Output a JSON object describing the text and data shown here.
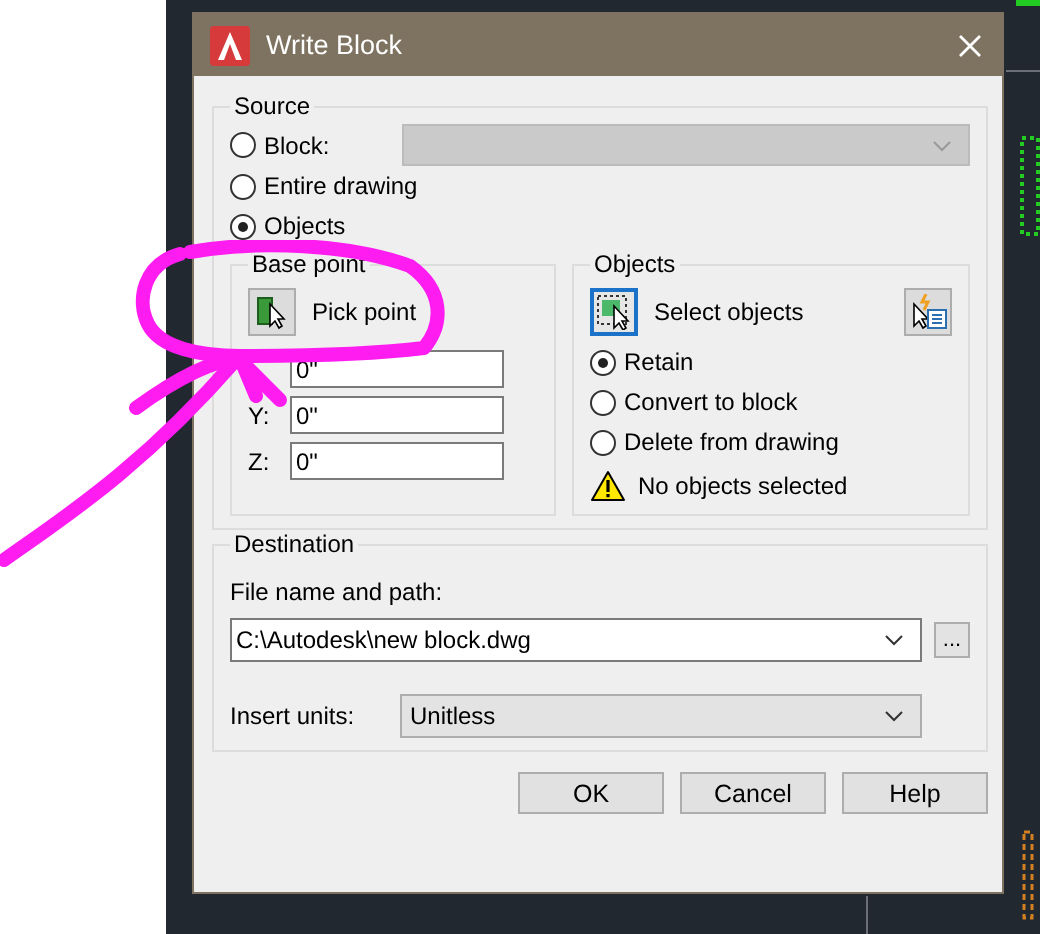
{
  "window": {
    "title": "Write Block"
  },
  "source": {
    "title": "Source",
    "options": [
      {
        "label": "Block:",
        "selected": false
      },
      {
        "label": "Entire drawing",
        "selected": false
      },
      {
        "label": "Objects",
        "selected": true
      }
    ],
    "block_select": {
      "disabled": true
    }
  },
  "base_point": {
    "title": "Base point",
    "pick_button": "Pick point",
    "fields": [
      {
        "value": "0\""
      },
      {
        "label": "Y:",
        "value": "0\""
      },
      {
        "label": "Z:",
        "value": "0\""
      }
    ]
  },
  "objects": {
    "title": "Objects",
    "select_button": "Select objects",
    "options": [
      {
        "label": "Retain",
        "selected": true
      },
      {
        "label": "Convert to block",
        "selected": false
      },
      {
        "label": "Delete from drawing",
        "selected": false
      }
    ],
    "warning": "No objects selected"
  },
  "destination": {
    "title": "Destination",
    "file_label": "File name and path:",
    "file_value": "C:\\Autodesk\\new block.dwg",
    "browse_button": "...",
    "units_label": "Insert units:",
    "units_value": "Unitless"
  },
  "buttons": [
    "OK",
    "Cancel",
    "Help"
  ],
  "annotation": {
    "kind": "freehand"
  }
}
